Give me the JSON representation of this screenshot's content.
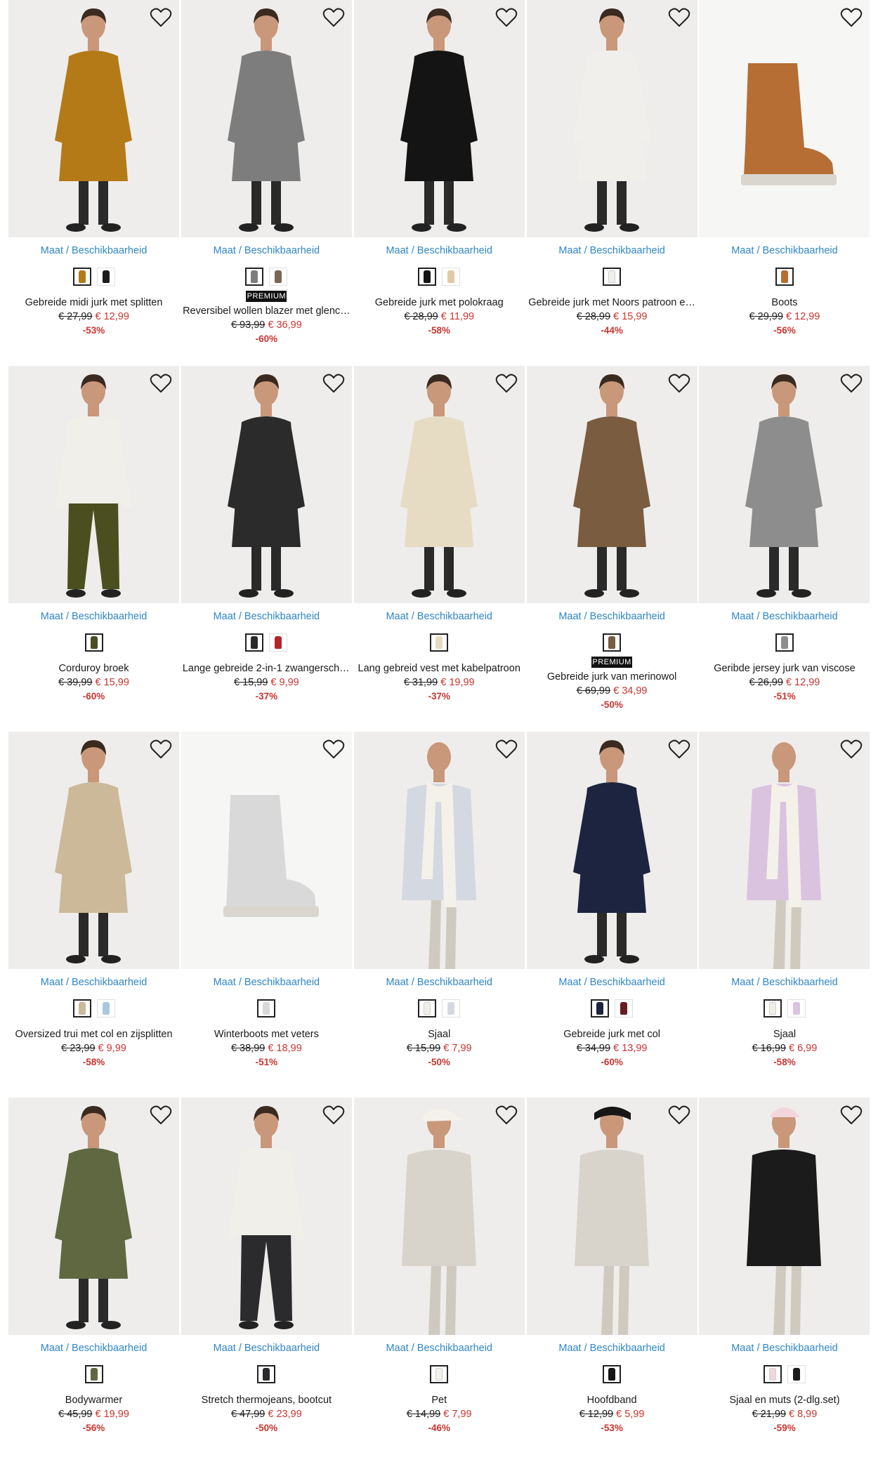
{
  "ui": {
    "size_link_label": "Maat / Beschikbaarheid",
    "premium_label": "PREMIUM"
  },
  "products": [
    {
      "name": "Gebreide midi jurk met splitten",
      "old_price": "€ 27,99",
      "new_price": "€ 12,99",
      "discount": "-53%",
      "premium": false,
      "colors": [
        "#b47a18",
        "#1c1c1c"
      ],
      "icon": "dress",
      "image": "model-mustard-knit-dress"
    },
    {
      "name": "Reversibel wollen blazer met glenc…",
      "old_price": "€ 93,99",
      "new_price": "€ 36,99",
      "discount": "-60%",
      "premium": true,
      "colors": [
        "#7d7d7d",
        "#7a6655"
      ],
      "icon": "coat",
      "image": "model-grey-blazer"
    },
    {
      "name": "Gebreide jurk met polokraag",
      "old_price": "€ 28,99",
      "new_price": "€ 11,99",
      "discount": "-58%",
      "premium": false,
      "colors": [
        "#141414",
        "#e2c9a6"
      ],
      "icon": "dress",
      "image": "model-black-polo-dress"
    },
    {
      "name": "Gebreide jurk met Noors patroon e…",
      "old_price": "€ 28,99",
      "new_price": "€ 15,99",
      "discount": "-44%",
      "premium": false,
      "colors": [
        "#f1efec"
      ],
      "icon": "dress",
      "image": "model-nordic-knit-dress"
    },
    {
      "name": "Boots",
      "old_price": "€ 29,99",
      "new_price": "€ 12,99",
      "discount": "-56%",
      "premium": false,
      "colors": [
        "#b66e34"
      ],
      "icon": "boot",
      "image": "camel-suede-boot"
    },
    {
      "name": "Corduroy broek",
      "old_price": "€ 39,99",
      "new_price": "€ 15,99",
      "discount": "-60%",
      "premium": false,
      "colors": [
        "#4b4f1f"
      ],
      "icon": "pants",
      "image": "model-olive-corduroy-pants"
    },
    {
      "name": "Lange gebreide 2-in-1 zwangerscha…",
      "old_price": "€ 15,99",
      "new_price": "€ 9,99",
      "discount": "-37%",
      "premium": false,
      "colors": [
        "#2b2b2b",
        "#b3252b"
      ],
      "icon": "sweater",
      "image": "model-maternity-jacquard-sweater"
    },
    {
      "name": "Lang gebreid vest met kabelpatroon",
      "old_price": "€ 31,99",
      "new_price": "€ 19,99",
      "discount": "-37%",
      "premium": false,
      "colors": [
        "#e6dcc4"
      ],
      "icon": "coat",
      "image": "model-cream-cable-cardigan"
    },
    {
      "name": "Gebreide jurk van merinowol",
      "old_price": "€ 69,99",
      "new_price": "€ 34,99",
      "discount": "-50%",
      "premium": true,
      "colors": [
        "#7a5c40"
      ],
      "icon": "dress",
      "image": "model-brown-merino-dress"
    },
    {
      "name": "Geribde jersey jurk van viscose",
      "old_price": "€ 26,99",
      "new_price": "€ 12,99",
      "discount": "-51%",
      "premium": false,
      "colors": [
        "#8d8d8d"
      ],
      "icon": "dress",
      "image": "model-grey-jersey-dress"
    },
    {
      "name": "Oversized trui met col en zijsplitten",
      "old_price": "€ 23,99",
      "new_price": "€ 9,99",
      "discount": "-58%",
      "premium": false,
      "colors": [
        "#cbb999",
        "#a9c7e0"
      ],
      "icon": "sweater",
      "image": "model-beige-oversized-sweater"
    },
    {
      "name": "Winterboots met veters",
      "old_price": "€ 38,99",
      "new_price": "€ 18,99",
      "discount": "-51%",
      "premium": false,
      "colors": [
        "#d9d9d9"
      ],
      "icon": "boot",
      "image": "white-lace-up-winter-boot"
    },
    {
      "name": "Sjaal",
      "old_price": "€ 15,99",
      "new_price": "€ 7,99",
      "discount": "-50%",
      "premium": false,
      "colors": [
        "#f2efe8",
        "#d4d8e0"
      ],
      "icon": "scarf",
      "image": "model-white-fluffy-scarf"
    },
    {
      "name": "Gebreide jurk met col",
      "old_price": "€ 34,99",
      "new_price": "€ 13,99",
      "discount": "-60%",
      "premium": false,
      "colors": [
        "#1d2440",
        "#6b1c1f"
      ],
      "icon": "dress",
      "image": "model-navy-ribbed-dress"
    },
    {
      "name": "Sjaal",
      "old_price": "€ 16,99",
      "new_price": "€ 6,99",
      "discount": "-58%",
      "premium": false,
      "colors": [
        "#f1eee5",
        "#d9c3df"
      ],
      "icon": "scarf",
      "image": "model-lime-sweater-white-scarf"
    },
    {
      "name": "Bodywarmer",
      "old_price": "€ 45,99",
      "new_price": "€ 19,99",
      "discount": "-56%",
      "premium": false,
      "colors": [
        "#5f6840"
      ],
      "icon": "coat",
      "image": "model-olive-long-bodywarmer"
    },
    {
      "name": "Stretch thermojeans, bootcut",
      "old_price": "€ 47,99",
      "new_price": "€ 23,99",
      "discount": "-50%",
      "premium": false,
      "colors": [
        "#2b2b2e"
      ],
      "icon": "pants",
      "image": "model-black-bootcut-jeans"
    },
    {
      "name": "Pet",
      "old_price": "€ 14,99",
      "new_price": "€ 7,99",
      "discount": "-46%",
      "premium": false,
      "colors": [
        "#f3f1ec"
      ],
      "icon": "cap",
      "image": "model-cream-cap-mint-sweater"
    },
    {
      "name": "Hoofdband",
      "old_price": "€ 12,99",
      "new_price": "€ 5,99",
      "discount": "-53%",
      "premium": false,
      "colors": [
        "#151515"
      ],
      "icon": "band",
      "image": "model-black-headband"
    },
    {
      "name": "Sjaal en muts (2-dlg.set)",
      "old_price": "€ 21,99",
      "new_price": "€ 8,99",
      "discount": "-59%",
      "premium": false,
      "colors": [
        "#f3d6dc",
        "#1b1b1b"
      ],
      "icon": "hat",
      "image": "model-pink-scarf-hat-set"
    }
  ]
}
